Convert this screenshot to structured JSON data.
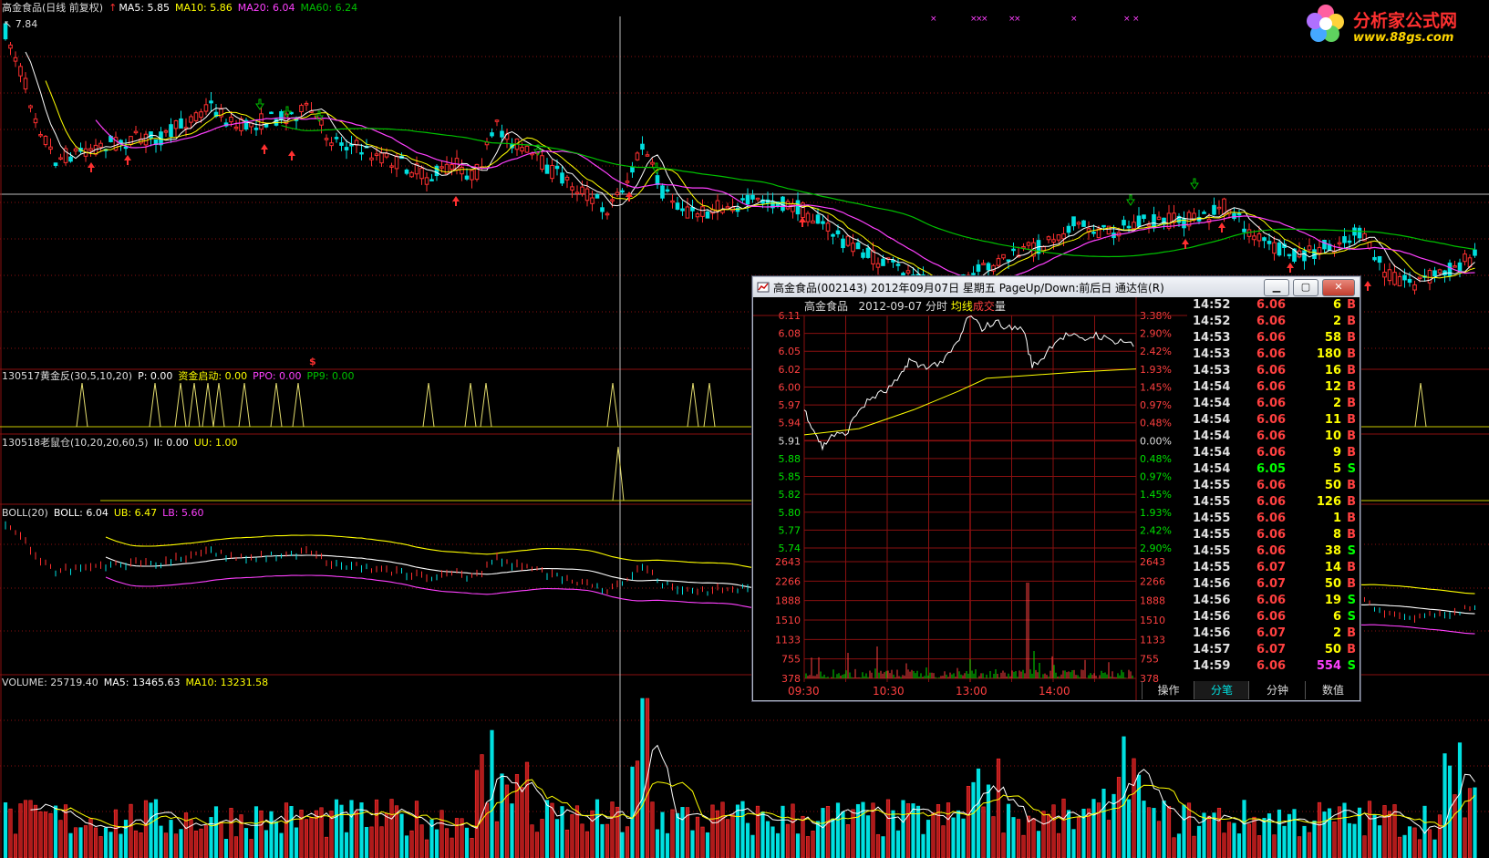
{
  "main": {
    "header": {
      "name": "高金食品(日线 前复权)",
      "ma5": "MA5: 5.85",
      "ma10": "MA10: 5.86",
      "ma20": "MA20: 6.04",
      "ma60": "MA60: 6.24"
    },
    "high_label": "7.84",
    "gold_marker": "$",
    "ind1": {
      "name": "130517黄金反(30,5,10,20)",
      "p": "P: 0.00",
      "zj": "资金启动: 0.00",
      "ppo": "PPO: 0.00",
      "pp9": "PP9: 0.00"
    },
    "ind2": {
      "name": "130518老鼠仓(10,20,20,60,5)",
      "ii": "II: 0.00",
      "uu": "UU: 1.00"
    },
    "boll": {
      "name": "BOLL(20)",
      "boll": "BOLL: 6.04",
      "ub": "UB: 6.47",
      "lb": "LB: 5.60"
    },
    "volume": {
      "name": "VOLUME: 25719.40",
      "ma5": "MA5: 13465.63",
      "ma10": "MA10: 13231.58"
    }
  },
  "logo": {
    "name": "分析家公式网",
    "url": "www.88gs.com"
  },
  "colors": {
    "up": "#ff3030",
    "down": "#00e0e0",
    "ma5": "#ffffff",
    "ma10": "#ffff00",
    "ma20": "#ff40ff",
    "ma60": "#00c000",
    "grid": "#8a1010"
  },
  "popup": {
    "title": "高金食品(002143) 2012年09月07日 星期五 PageUp/Down:前后日 通达信(R)",
    "stock": "高金食品",
    "date": "2012-09-07 分时",
    "avg_label": "均线",
    "vol_label_1": "成交",
    "vol_label_2": "量",
    "price_axis": [
      "6.11",
      "6.08",
      "6.05",
      "6.02",
      "6.00",
      "5.97",
      "5.94",
      "5.91",
      "5.88",
      "5.85",
      "5.82",
      "5.80",
      "5.77",
      "5.74"
    ],
    "pct_axis": [
      "3.38%",
      "2.90%",
      "2.42%",
      "1.93%",
      "1.45%",
      "0.97%",
      "0.48%",
      "0.00%",
      "0.48%",
      "0.97%",
      "1.45%",
      "1.93%",
      "2.42%",
      "2.90%"
    ],
    "vol_axis": [
      "2643",
      "2266",
      "1888",
      "1510",
      "1133",
      "755",
      "378"
    ],
    "time_axis": [
      "09:30",
      "10:30",
      "13:00",
      "14:00"
    ],
    "ticks": [
      {
        "t": "14:52",
        "p": "6.06",
        "v": "6",
        "s": "B"
      },
      {
        "t": "14:52",
        "p": "6.06",
        "v": "2",
        "s": "B"
      },
      {
        "t": "14:53",
        "p": "6.06",
        "v": "58",
        "s": "B"
      },
      {
        "t": "14:53",
        "p": "6.06",
        "v": "180",
        "s": "B"
      },
      {
        "t": "14:53",
        "p": "6.06",
        "v": "16",
        "s": "B"
      },
      {
        "t": "14:54",
        "p": "6.06",
        "v": "12",
        "s": "B"
      },
      {
        "t": "14:54",
        "p": "6.06",
        "v": "2",
        "s": "B"
      },
      {
        "t": "14:54",
        "p": "6.06",
        "v": "11",
        "s": "B"
      },
      {
        "t": "14:54",
        "p": "6.06",
        "v": "10",
        "s": "B"
      },
      {
        "t": "14:54",
        "p": "6.06",
        "v": "9",
        "s": "B"
      },
      {
        "t": "14:54",
        "p": "6.05",
        "v": "5",
        "s": "S"
      },
      {
        "t": "14:55",
        "p": "6.06",
        "v": "50",
        "s": "B"
      },
      {
        "t": "14:55",
        "p": "6.06",
        "v": "126",
        "s": "B"
      },
      {
        "t": "14:55",
        "p": "6.06",
        "v": "1",
        "s": "B"
      },
      {
        "t": "14:55",
        "p": "6.06",
        "v": "8",
        "s": "B"
      },
      {
        "t": "14:55",
        "p": "6.06",
        "v": "38",
        "s": "S"
      },
      {
        "t": "14:55",
        "p": "6.07",
        "v": "14",
        "s": "B"
      },
      {
        "t": "14:56",
        "p": "6.07",
        "v": "50",
        "s": "B"
      },
      {
        "t": "14:56",
        "p": "6.06",
        "v": "19",
        "s": "S"
      },
      {
        "t": "14:56",
        "p": "6.06",
        "v": "6",
        "s": "S"
      },
      {
        "t": "14:56",
        "p": "6.07",
        "v": "2",
        "s": "B"
      },
      {
        "t": "14:57",
        "p": "6.07",
        "v": "50",
        "s": "B"
      },
      {
        "t": "14:59",
        "p": "6.06",
        "v": "554",
        "s": "S"
      }
    ],
    "tabs": [
      "操作",
      "分笔",
      "分钟",
      "数值"
    ],
    "active_tab": "分笔"
  }
}
